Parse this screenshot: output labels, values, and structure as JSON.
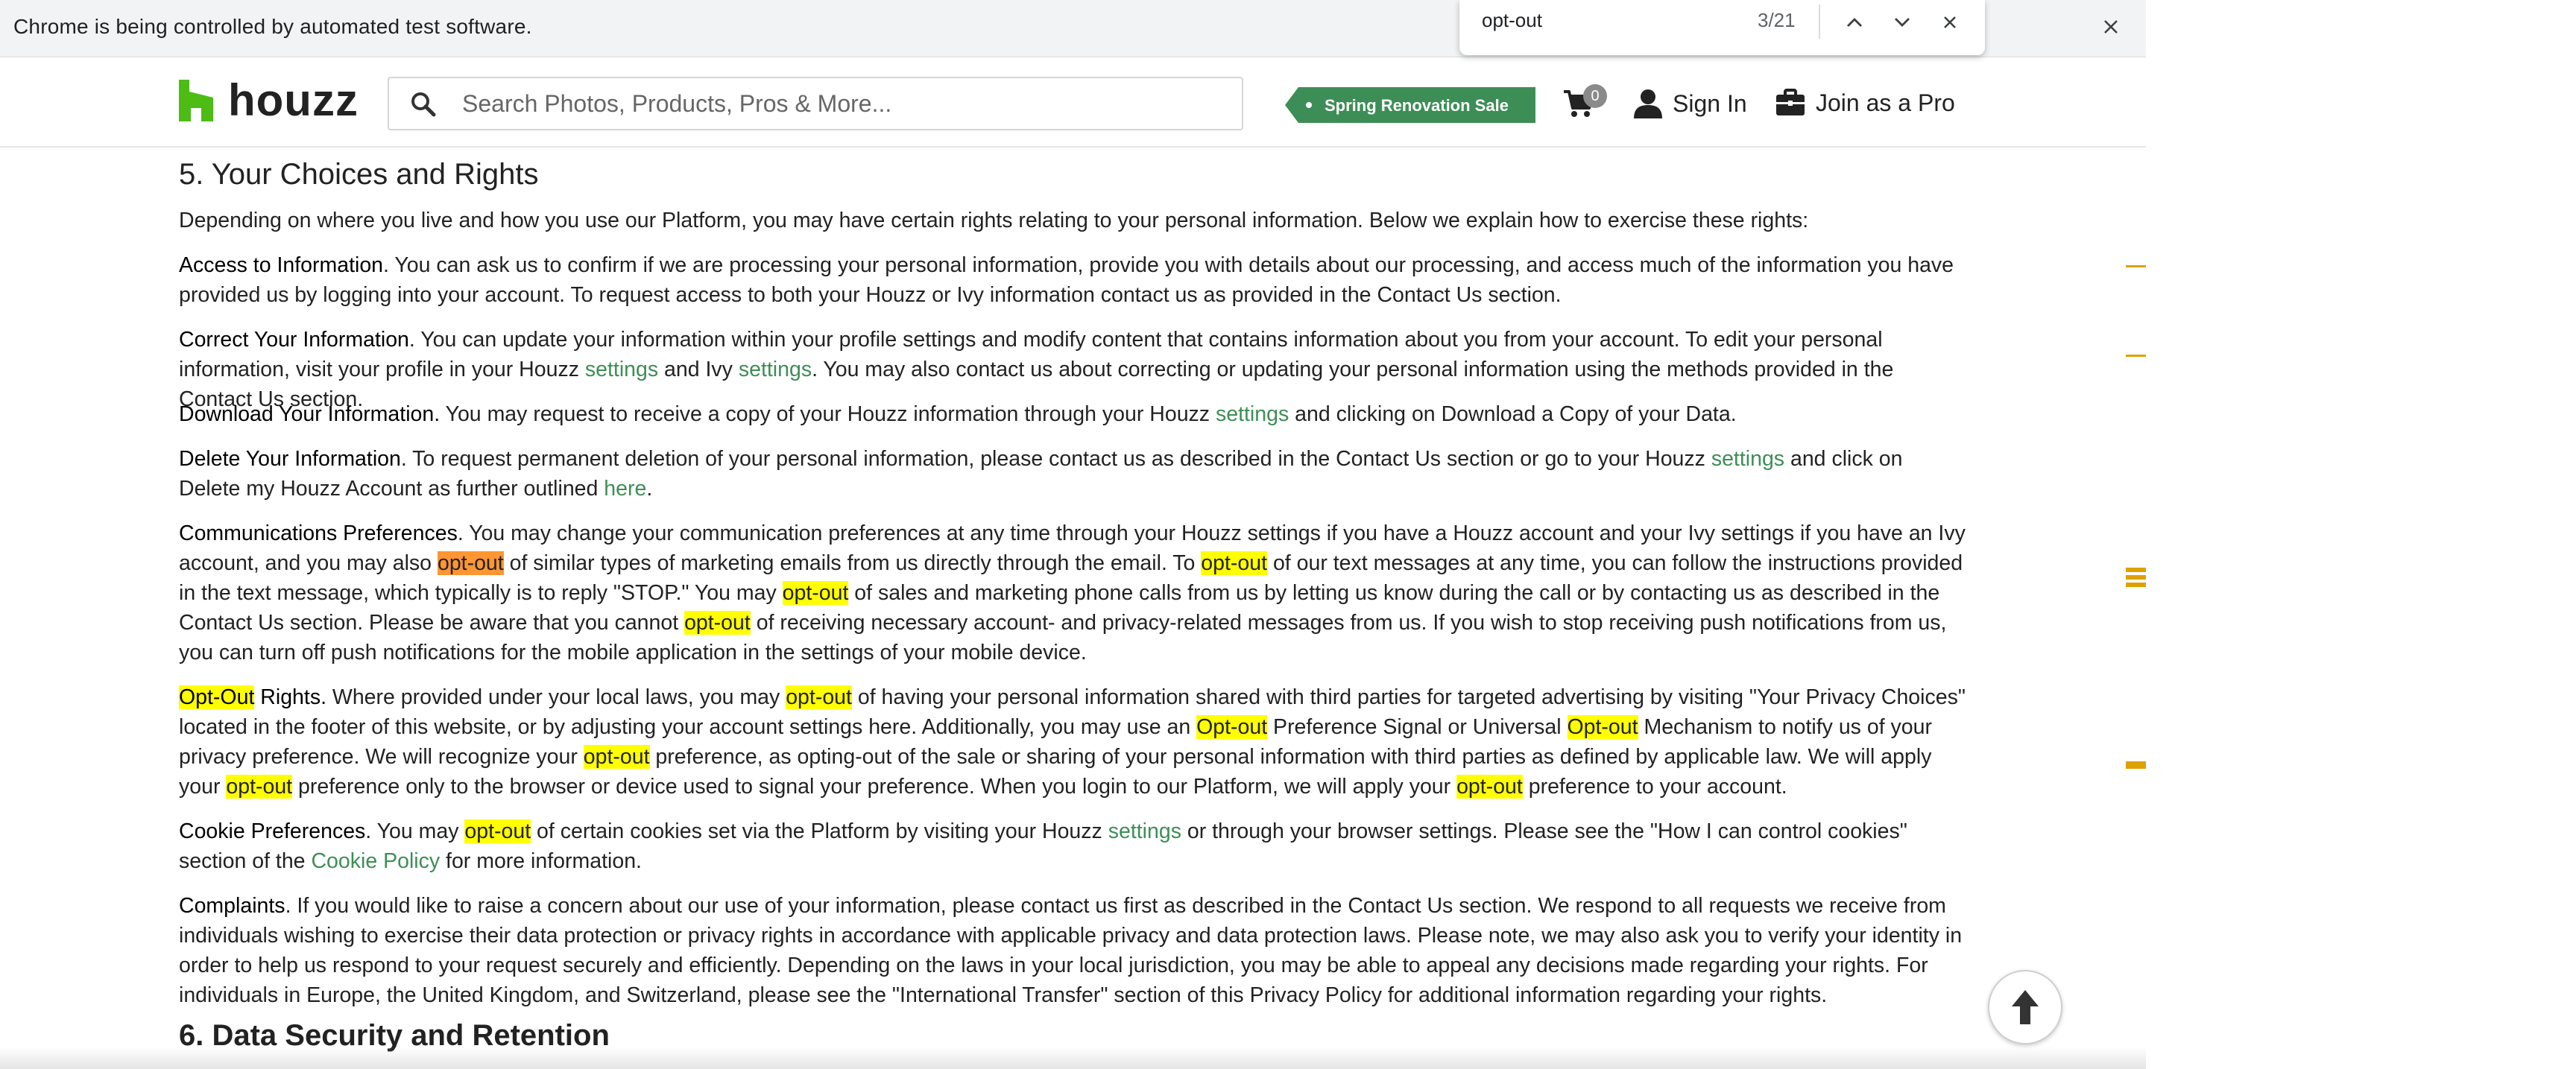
{
  "infobar": {
    "message": "Chrome is being controlled by automated test software."
  },
  "findbar": {
    "query": "opt-out",
    "count": "3/21"
  },
  "header": {
    "logo": "houzz",
    "search_placeholder": "Search Photos, Products, Pros & More...",
    "promo": "Spring Renovation Sale",
    "cart_count": "0",
    "sign_in": "Sign In",
    "join_pro": "Join as a Pro"
  },
  "section5": {
    "heading": "5. Your Choices and Rights",
    "intro": "Depending on where you live and how you use our Platform, you may have certain rights relating to your personal information. Below we explain how to exercise these rights:",
    "access": {
      "title": "Access to Information",
      "text": ". You can ask us to confirm if we are processing your personal information, provide you with details about our processing, and access much of the information you have provided us by logging into your account. To request access to both your Houzz or Ivy information contact us as provided in the Contact Us section."
    },
    "correct": {
      "title": "Correct Your Information",
      "t1": ". You can update your information within your profile settings and modify content that contains information about you from your account. To edit your personal information, visit your profile in your Houzz ",
      "link1": "settings",
      "t2": " and Ivy ",
      "link2": "settings",
      "t3": ". You may also contact us about correcting or updating your personal information using the methods provided in the Contact Us section."
    },
    "download": {
      "title": "Download Your Information.",
      "t1": " You may request to receive a copy of your Houzz information through your Houzz ",
      "link": "settings",
      "t2": " and clicking on Download a Copy of your Data."
    },
    "delete": {
      "title": "Delete Your Information",
      "t1": ". To request permanent deletion of your personal information, please contact us as described in the Contact Us section or go to your Houzz ",
      "link1": "settings",
      "t2": " and click on Delete my Houzz Account as further outlined ",
      "link2": "here",
      "t3": "."
    },
    "communications": {
      "title": "Communications Preferences",
      "t1": ". You may change your communication preferences at any time through your Houzz settings if you have a Houzz account and your Ivy settings if you have an Ivy account, and you may also ",
      "h1": "opt-out",
      "t2": " of similar types of marketing emails from us directly through the email. To ",
      "h2": "opt-out",
      "t3": " of our text messages at any time, you can follow the instructions provided in the text message, which typically is to reply \"STOP.\" You may ",
      "h3": "opt-out",
      "t4": " of sales and marketing phone calls from us by letting us know during the call or by contacting us as described in the Contact Us section. Please be aware that you cannot ",
      "h4": "opt-out",
      "t5": " of receiving necessary account- and privacy-related messages from us. If you wish to stop receiving push notifications from us, you can turn off push notifications for the mobile application in the settings of your mobile device."
    },
    "optout_rights": {
      "title_hl": "Opt-Out",
      "title_rest": " Rights.",
      "t1": " Where provided under your local laws, you may ",
      "h1": "opt-out",
      "t2": " of having your personal information shared with third parties for targeted advertising by visiting \"Your Privacy Choices\" located in the footer of this website, or by adjusting your account settings here. Additionally, you may use an ",
      "h2": "Opt-out",
      "t3": " Preference Signal or Universal ",
      "h3": "Opt-out",
      "t4": " Mechanism to notify us of your privacy preference. We will recognize your ",
      "h4": "opt-out",
      "t5": " preference, as opting-out of the sale or sharing of your personal information with third parties as defined by applicable law. We will apply your ",
      "h5": "opt-out",
      "t6": " preference only to the browser or device used to signal your preference. When you login to our Platform, we will apply your ",
      "h6": "opt-out",
      "t7": " preference to your account."
    },
    "cookie": {
      "title": "Cookie Preferences",
      "t1": ". You may ",
      "h1": "opt-out",
      "t2": " of certain cookies set via the Platform by visiting your Houzz ",
      "link1": "settings",
      "t3": " or through your browser settings. Please see the \"How I can control cookies\" section of the ",
      "link2": "Cookie Policy",
      "t4": " for more information."
    },
    "complaints": {
      "title": "Complaints",
      "text": ". If you would like to raise a concern about our use of your information, please contact us first as described in the Contact Us section. We respond to all requests we receive from individuals wishing to exercise their data protection or privacy rights in accordance with applicable privacy and data protection laws. Please note, we may also ask you to verify your identity in order to help us respond to your request securely and efficiently. Depending on the laws in your local jurisdiction, you may be able to appeal any decisions made regarding your rights. For individuals in Europe, the United Kingdom, and Switzerland, please see the \"International Transfer\" section of this Privacy Policy for additional information regarding your rights."
    }
  },
  "section6": {
    "heading": "6. Data Security and Retention"
  },
  "colors": {
    "brand_green": "#3d8e56",
    "find_highlight": "#ffff00",
    "find_active": "#ff9632"
  }
}
